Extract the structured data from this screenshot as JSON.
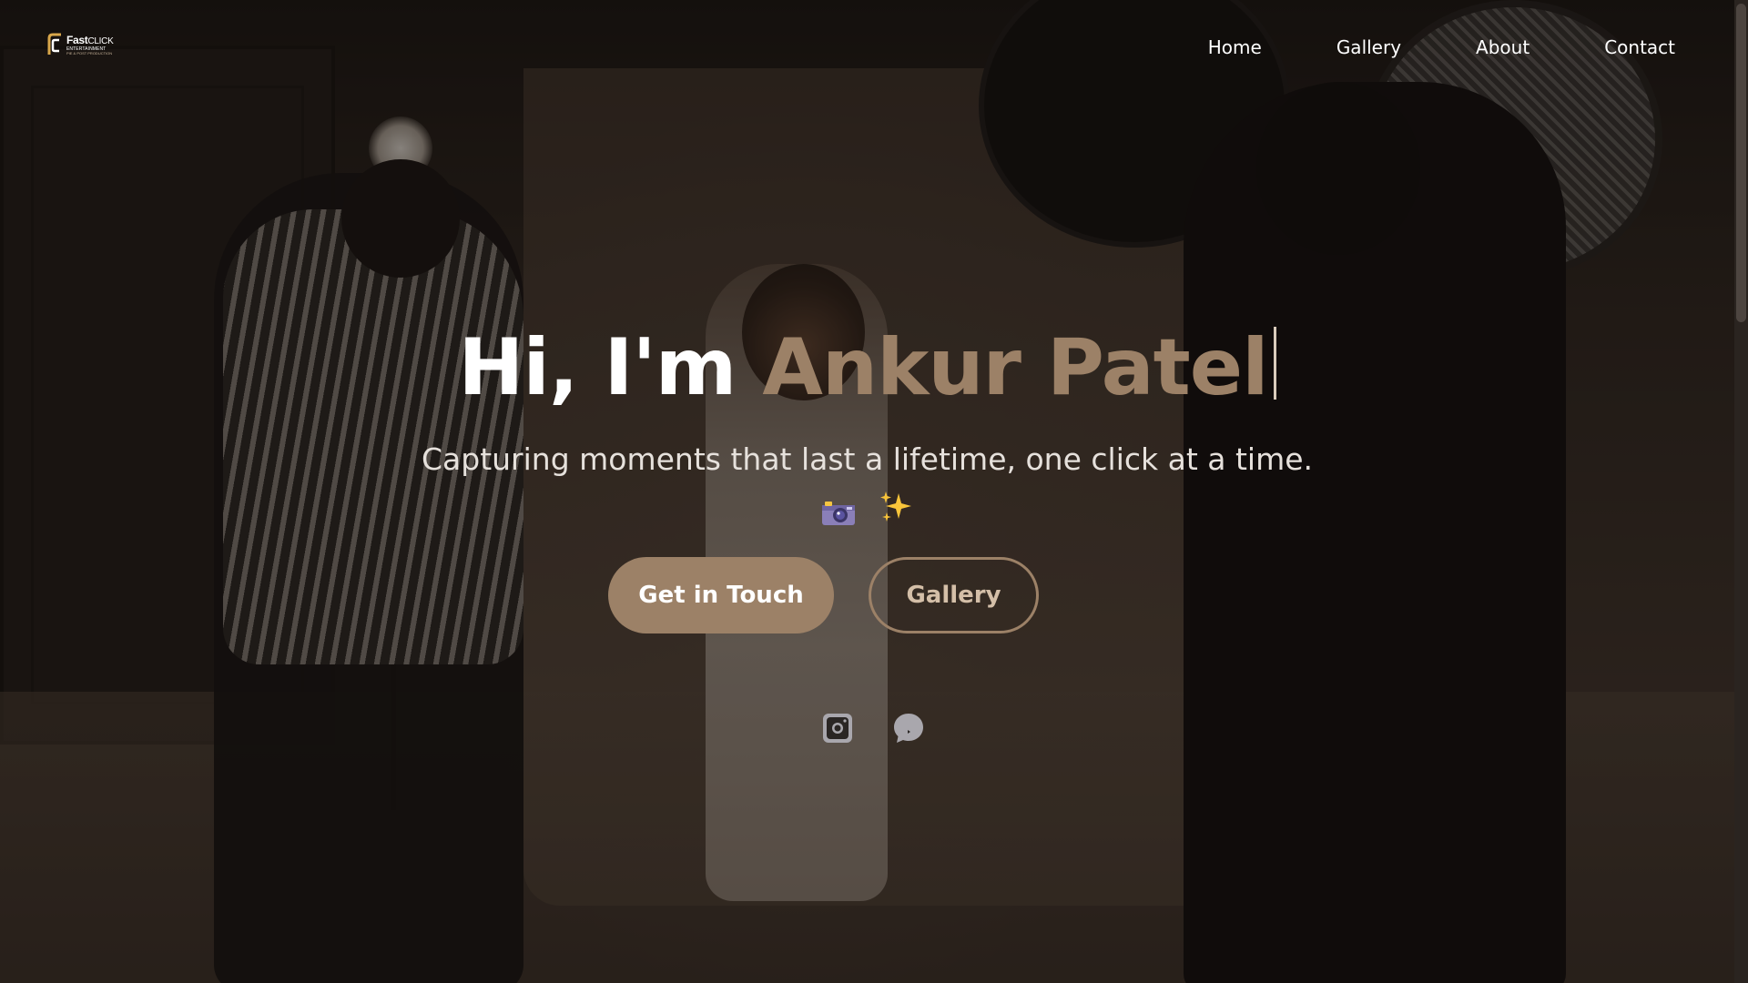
{
  "logo": {
    "brand_bold": "Fast",
    "brand_light": "CLICK",
    "subtitle": "ENTERTAINMENT",
    "tagline": "PIE & POST PRODUCTION"
  },
  "nav": {
    "items": [
      {
        "label": "Home"
      },
      {
        "label": "Gallery"
      },
      {
        "label": "About"
      },
      {
        "label": "Contact"
      }
    ]
  },
  "hero": {
    "greeting": "Hi, I'm ",
    "name": "Ankur Patel",
    "tagline": "Capturing moments that last a lifetime, one click at a time.",
    "emoji": [
      "camera-with-flash-icon",
      "sparkles-icon"
    ]
  },
  "buttons": {
    "primary_label": "Get in Touch",
    "secondary_label": "Gallery"
  },
  "socials": [
    {
      "icon": "instagram-icon"
    },
    {
      "icon": "chat-bubble-icon"
    }
  ],
  "colors": {
    "accent": "#9c8167",
    "text": "#ffffff",
    "secondary_text": "#d4bfa8",
    "overlay": "#120e0b"
  }
}
